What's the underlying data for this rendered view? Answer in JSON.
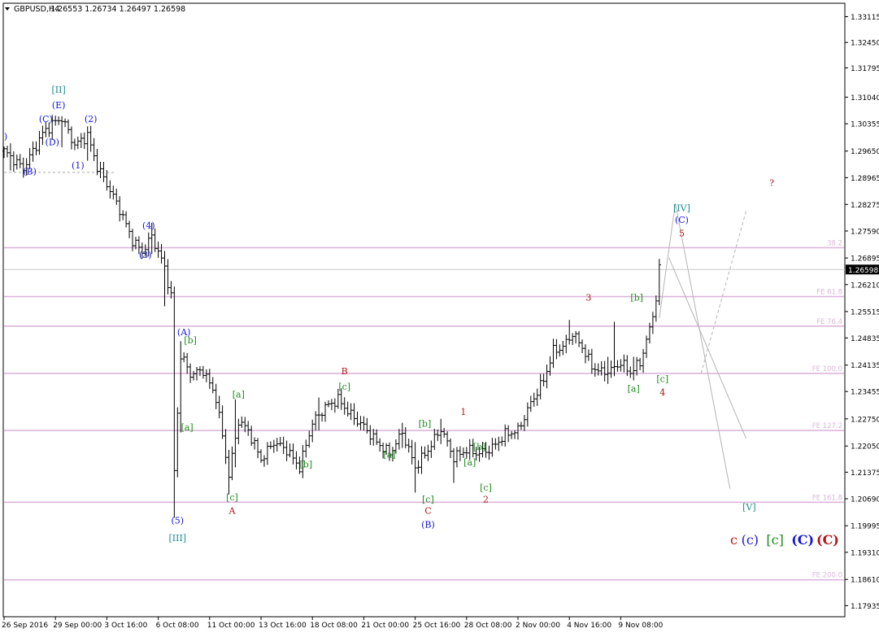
{
  "header": {
    "symbol": "GBPUSD,H4",
    "ohlc": "1.26553 1.26734 1.26497 1.26598",
    "menu_icon": "triangle-down-icon"
  },
  "colors": {
    "bar": "#000000",
    "fib_line": "#dcb6dc",
    "fib_text": "#d8b8d8",
    "price_line": "#c8c8c8",
    "blue": "#1414dc",
    "green": "#1a8a1a",
    "red": "#b41414",
    "teal": "#1a8a8a",
    "projection": "#b4b4b4",
    "price_box": "#000000"
  },
  "chart_data": {
    "type": "ohlc",
    "title": "GBPUSD,H4",
    "ylim": [
      1.1765,
      1.3346
    ],
    "price_ticks": [
      "1.33115",
      "1.32450",
      "1.31795",
      "1.31040",
      "1.30355",
      "1.29650",
      "1.28965",
      "1.28275",
      "1.27590",
      "1.26895",
      "1.26210",
      "1.25515",
      "1.24835",
      "1.24135",
      "1.23455",
      "1.22750",
      "1.22050",
      "1.21375",
      "1.20690",
      "1.19995",
      "1.19310",
      "1.18610",
      "1.17935"
    ],
    "current_price": "1.26598",
    "x_labels": [
      "26 Sep 2016",
      "29 Sep 00:00",
      "3 Oct 16:00",
      "6 Oct 08:00",
      "11 Oct 00:00",
      "13 Oct 16:00",
      "18 Oct 08:00",
      "21 Oct 00:00",
      "25 Oct 16:00",
      "28 Oct 08:00",
      "2 Nov 00:00",
      "4 Nov 16:00",
      "9 Nov 08:00"
    ],
    "x_label_bar_index": [
      0,
      16,
      32,
      48,
      64,
      80,
      96,
      112,
      128,
      144,
      160,
      176,
      192
    ],
    "bar_count": 205,
    "fib_levels": [
      {
        "label": "38.2",
        "price": 1.2716
      },
      {
        "label": "FE 61.8",
        "price": 1.259
      },
      {
        "label": "FE 76.4",
        "price": 1.2514
      },
      {
        "label": "FE 100.0",
        "price": 1.2392
      },
      {
        "label": "FE 127.2",
        "price": 1.2245
      },
      {
        "label": "FE 161.8",
        "price": 1.206
      },
      {
        "label": "FE 200.0",
        "price": 1.186
      }
    ],
    "dashed_level_price": 1.291,
    "anchors": [
      {
        "i": 0,
        "p": 1.2965
      },
      {
        "i": 6,
        "p": 1.292
      },
      {
        "i": 12,
        "p": 1.301
      },
      {
        "i": 15,
        "p": 1.3035
      },
      {
        "i": 18,
        "p": 1.305
      },
      {
        "i": 22,
        "p": 1.298
      },
      {
        "i": 26,
        "p": 1.3005
      },
      {
        "i": 29,
        "p": 1.2925
      },
      {
        "i": 32,
        "p": 1.288
      },
      {
        "i": 36,
        "p": 1.2815
      },
      {
        "i": 40,
        "p": 1.2735
      },
      {
        "i": 43,
        "p": 1.2705
      },
      {
        "i": 46,
        "p": 1.2745
      },
      {
        "i": 50,
        "p": 1.2665
      },
      {
        "i": 52,
        "p": 1.259
      },
      {
        "i": 53,
        "p": 1.214
      },
      {
        "i": 55,
        "p": 1.244
      },
      {
        "i": 58,
        "p": 1.239
      },
      {
        "i": 62,
        "p": 1.24
      },
      {
        "i": 66,
        "p": 1.233
      },
      {
        "i": 70,
        "p": 1.213
      },
      {
        "i": 73,
        "p": 1.227
      },
      {
        "i": 76,
        "p": 1.2245
      },
      {
        "i": 80,
        "p": 1.217
      },
      {
        "i": 84,
        "p": 1.2215
      },
      {
        "i": 88,
        "p": 1.2195
      },
      {
        "i": 92,
        "p": 1.215
      },
      {
        "i": 96,
        "p": 1.2265
      },
      {
        "i": 100,
        "p": 1.2305
      },
      {
        "i": 104,
        "p": 1.2325
      },
      {
        "i": 108,
        "p": 1.2285
      },
      {
        "i": 112,
        "p": 1.2255
      },
      {
        "i": 116,
        "p": 1.2215
      },
      {
        "i": 120,
        "p": 1.2185
      },
      {
        "i": 124,
        "p": 1.224
      },
      {
        "i": 128,
        "p": 1.215
      },
      {
        "i": 132,
        "p": 1.2195
      },
      {
        "i": 136,
        "p": 1.225
      },
      {
        "i": 140,
        "p": 1.2175
      },
      {
        "i": 144,
        "p": 1.2195
      },
      {
        "i": 148,
        "p": 1.2185
      },
      {
        "i": 152,
        "p": 1.22
      },
      {
        "i": 156,
        "p": 1.2235
      },
      {
        "i": 160,
        "p": 1.2245
      },
      {
        "i": 164,
        "p": 1.2315
      },
      {
        "i": 168,
        "p": 1.2375
      },
      {
        "i": 171,
        "p": 1.245
      },
      {
        "i": 174,
        "p": 1.246
      },
      {
        "i": 177,
        "p": 1.2495
      },
      {
        "i": 180,
        "p": 1.246
      },
      {
        "i": 183,
        "p": 1.241
      },
      {
        "i": 186,
        "p": 1.2395
      },
      {
        "i": 189,
        "p": 1.24
      },
      {
        "i": 192,
        "p": 1.242
      },
      {
        "i": 195,
        "p": 1.2395
      },
      {
        "i": 198,
        "p": 1.242
      },
      {
        "i": 201,
        "p": 1.2505
      },
      {
        "i": 203,
        "p": 1.2585
      },
      {
        "i": 204,
        "p": 1.266
      }
    ],
    "spikes": [
      {
        "i": 2,
        "h": 1.2985,
        "l": 1.2915
      },
      {
        "i": 18,
        "h": 1.3055,
        "l": 1.2975
      },
      {
        "i": 26,
        "h": 1.302,
        "l": 1.294
      },
      {
        "i": 46,
        "h": 1.278,
        "l": 1.27
      },
      {
        "i": 50,
        "h": 1.266,
        "l": 1.2565
      },
      {
        "i": 53,
        "h": 1.258,
        "l": 1.202
      },
      {
        "i": 55,
        "h": 1.2475,
        "l": 1.224
      },
      {
        "i": 70,
        "h": 1.2195,
        "l": 1.208
      },
      {
        "i": 72,
        "h": 1.2325,
        "l": 1.215
      },
      {
        "i": 98,
        "h": 1.233,
        "l": 1.2245
      },
      {
        "i": 124,
        "h": 1.2265,
        "l": 1.22
      },
      {
        "i": 128,
        "h": 1.2215,
        "l": 1.2085
      },
      {
        "i": 136,
        "h": 1.2275,
        "l": 1.221
      },
      {
        "i": 140,
        "h": 1.2185,
        "l": 1.211
      },
      {
        "i": 176,
        "h": 1.253,
        "l": 1.247
      },
      {
        "i": 188,
        "h": 1.2435,
        "l": 1.2365
      },
      {
        "i": 190,
        "h": 1.2525,
        "l": 1.2385
      },
      {
        "i": 196,
        "h": 1.2435,
        "l": 1.2375
      },
      {
        "i": 199,
        "h": 1.2455,
        "l": 1.2395
      }
    ],
    "projections": [
      {
        "style": "solid",
        "points": [
          {
            "i": 204,
            "p": 1.2535
          },
          {
            "i": 209,
            "p": 1.283
          },
          {
            "i": 226,
            "p": 1.2095
          }
        ]
      },
      {
        "style": "solid",
        "points": [
          {
            "i": 207,
            "p": 1.269
          },
          {
            "i": 231,
            "p": 1.2225
          }
        ]
      },
      {
        "style": "dashed",
        "points": [
          {
            "i": 217,
            "p": 1.2392
          },
          {
            "i": 231,
            "p": 1.281
          }
        ]
      }
    ],
    "wave_labels": [
      {
        "text": ")",
        "i": 0.5,
        "p": 1.2995,
        "color": "blue"
      },
      {
        "text": "(B)",
        "i": 8,
        "p": 1.2905,
        "color": "blue"
      },
      {
        "text": "(C)",
        "i": 13,
        "p": 1.304,
        "color": "blue"
      },
      {
        "text": "(D)",
        "i": 15,
        "p": 1.298,
        "color": "blue"
      },
      {
        "text": "(E)",
        "i": 17,
        "p": 1.3075,
        "color": "blue"
      },
      {
        "text": "[II]",
        "i": 17,
        "p": 1.3115,
        "color": "teal"
      },
      {
        "text": "(1)",
        "i": 23,
        "p": 1.292,
        "color": "blue"
      },
      {
        "text": "(2)",
        "i": 27,
        "p": 1.304,
        "color": "blue"
      },
      {
        "text": "(4)",
        "i": 45,
        "p": 1.2765,
        "color": "blue"
      },
      {
        "text": "(3)",
        "i": 44,
        "p": 1.269,
        "color": "blue"
      },
      {
        "text": "(A)",
        "i": 56,
        "p": 1.249,
        "color": "blue"
      },
      {
        "text": "[b]",
        "i": 58,
        "p": 1.247,
        "color": "green"
      },
      {
        "text": "[a]",
        "i": 57,
        "p": 1.2245,
        "color": "green"
      },
      {
        "text": "(5)",
        "i": 54,
        "p": 1.2005,
        "color": "blue"
      },
      {
        "text": "[III]",
        "i": 54,
        "p": 1.196,
        "color": "teal"
      },
      {
        "text": "[a]",
        "i": 73,
        "p": 1.233,
        "color": "green"
      },
      {
        "text": "[c]",
        "i": 71,
        "p": 1.2065,
        "color": "green"
      },
      {
        "text": "A",
        "i": 71,
        "p": 1.203,
        "color": "red"
      },
      {
        "text": "[b]",
        "i": 94,
        "p": 1.215,
        "color": "green"
      },
      {
        "text": "B",
        "i": 106,
        "p": 1.239,
        "color": "red"
      },
      {
        "text": "[c]",
        "i": 106,
        "p": 1.235,
        "color": "green"
      },
      {
        "text": "[a]",
        "i": 120,
        "p": 1.2175,
        "color": "green"
      },
      {
        "text": "[b]",
        "i": 131,
        "p": 1.2255,
        "color": "green"
      },
      {
        "text": "[c]",
        "i": 132,
        "p": 1.206,
        "color": "green"
      },
      {
        "text": "C",
        "i": 132,
        "p": 1.203,
        "color": "red"
      },
      {
        "text": "(B)",
        "i": 132,
        "p": 1.1995,
        "color": "blue"
      },
      {
        "text": "1",
        "i": 143,
        "p": 1.2285,
        "color": "red"
      },
      {
        "text": "[b]",
        "i": 148,
        "p": 1.2195,
        "color": "green"
      },
      {
        "text": "[a]",
        "i": 145,
        "p": 1.2155,
        "color": "green"
      },
      {
        "text": "[c]",
        "i": 150,
        "p": 1.209,
        "color": "green"
      },
      {
        "text": "2",
        "i": 150,
        "p": 1.206,
        "color": "red"
      },
      {
        "text": "3",
        "i": 182,
        "p": 1.258,
        "color": "red"
      },
      {
        "text": "[b]",
        "i": 197,
        "p": 1.258,
        "color": "green"
      },
      {
        "text": "[a]",
        "i": 196,
        "p": 1.2345,
        "color": "green"
      },
      {
        "text": "[c]",
        "i": 205,
        "p": 1.237,
        "color": "green"
      },
      {
        "text": "4",
        "i": 205,
        "p": 1.2335,
        "color": "red"
      },
      {
        "text": "[IV]",
        "i": 211,
        "p": 1.281,
        "color": "teal"
      },
      {
        "text": "(C)",
        "i": 211,
        "p": 1.278,
        "color": "blue"
      },
      {
        "text": "5",
        "i": 211,
        "p": 1.2745,
        "color": "red"
      },
      {
        "text": "?",
        "i": 239,
        "p": 1.2875,
        "color": "red"
      },
      {
        "text": "[V]",
        "i": 232,
        "p": 1.204,
        "color": "teal"
      }
    ],
    "legend": [
      {
        "text": "c",
        "color": "red",
        "weight": "normal"
      },
      {
        "text": "(c)",
        "color": "blue",
        "weight": "normal"
      },
      {
        "text": "[c]",
        "color": "green",
        "weight": "normal"
      },
      {
        "text": "(C)",
        "color": "blue",
        "weight": "bold"
      },
      {
        "text": "(C)",
        "color": "red",
        "weight": "bold"
      }
    ]
  }
}
